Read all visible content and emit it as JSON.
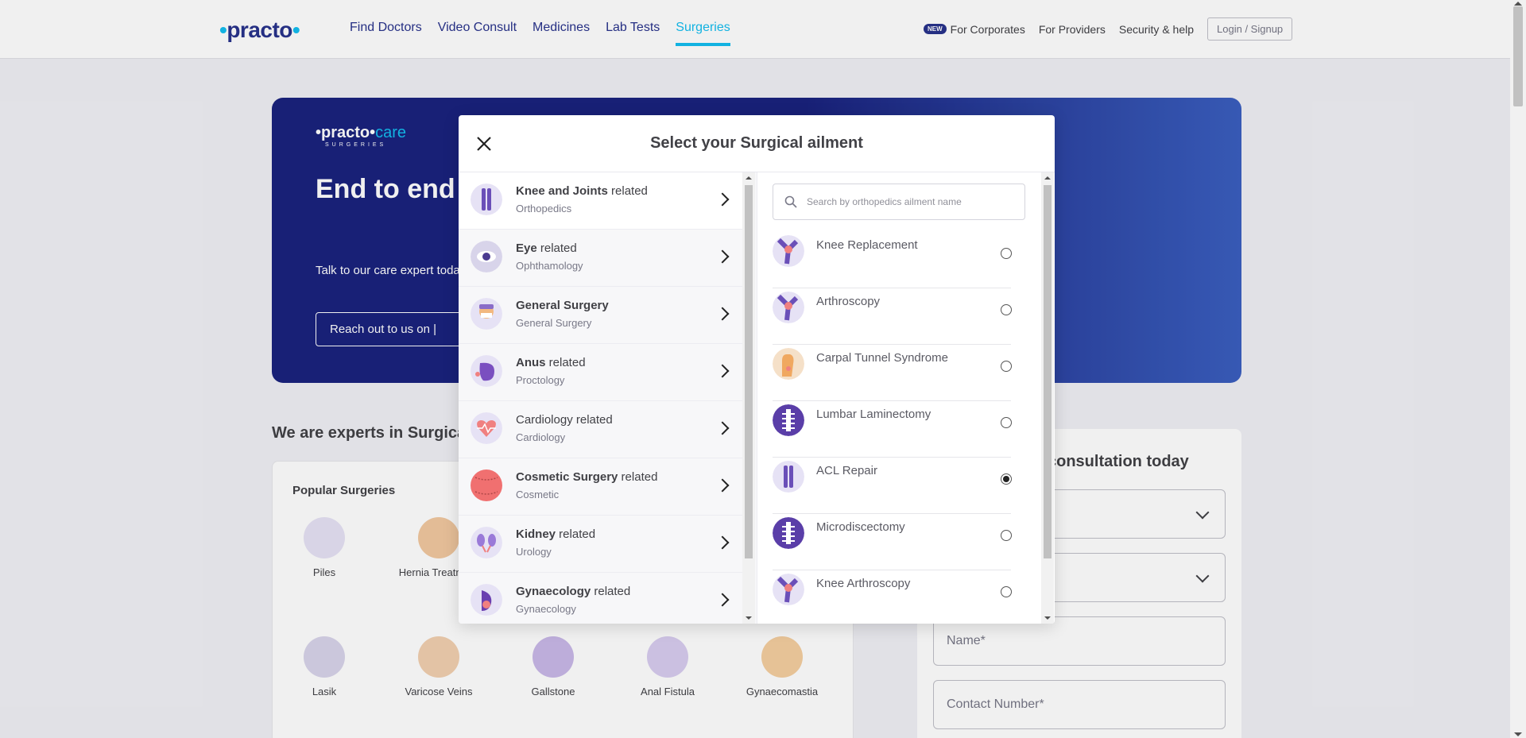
{
  "header": {
    "logo": "practo",
    "nav": [
      "Find Doctors",
      "Video Consult",
      "Medicines",
      "Lab Tests",
      "Surgeries"
    ],
    "active_nav": "Surgeries",
    "new_badge": "NEW",
    "right_links": [
      "For Corporates",
      "For Providers",
      "Security & help"
    ],
    "login_label": "Login / Signup"
  },
  "banner": {
    "logo_main": "•practo•",
    "logo_care": "care",
    "logo_sub": "SURGERIES",
    "title": "End to end care at our Practo",
    "subtitle": "Talk to our care expert today. All insurance accepted & No",
    "button_label": "Reach out to us on   |"
  },
  "experts_heading": "We are experts in Surgical",
  "popular": {
    "title": "Popular Surgeries",
    "items": [
      {
        "label": "Piles",
        "color": "#6a5acd"
      },
      {
        "label": "Hernia Treatment",
        "color": "#e8a66a"
      },
      {
        "label": "Lasik",
        "color": "#5a4aa0"
      },
      {
        "label": "Varicose Veins",
        "color": "#e8a66a"
      },
      {
        "label": "Gallstone",
        "color": "#8a6cc8"
      },
      {
        "label": "Anal Fistula",
        "color": "#5a3ea8"
      },
      {
        "label": "Gynaecomastia",
        "color": "#f0a860"
      }
    ]
  },
  "consult": {
    "title": "consultation today",
    "name_placeholder": "Name*",
    "contact_placeholder": "Contact Number*"
  },
  "modal": {
    "title": "Select your Surgical ailment",
    "categories": [
      {
        "bold": "Knee and Joints",
        "rest": " related",
        "sub": "Orthopedics",
        "color": "#6a4fb8"
      },
      {
        "bold": "Eye",
        "rest": " related",
        "sub": "Ophthamology",
        "color": "#4a3a90"
      },
      {
        "bold": "General Surgery",
        "rest": "",
        "sub": "General Surgery",
        "color": "#f2b880"
      },
      {
        "bold": "Anus",
        "rest": " related",
        "sub": "Proctology",
        "color": "#7a4fc0"
      },
      {
        "bold": "",
        "rest": "Cardiology related",
        "sub": "Cardiology",
        "color": "#f08080"
      },
      {
        "bold": "Cosmetic Surgery",
        "rest": " related",
        "sub": "Cosmetic",
        "color": "#f07070"
      },
      {
        "bold": "Kidney",
        "rest": " related",
        "sub": "Urology",
        "color": "#9a7ad8"
      },
      {
        "bold": "Gynaecology",
        "rest": " related",
        "sub": "Gynaecology",
        "color": "#6a3fb0"
      }
    ],
    "search_placeholder": "Search by orthopedics ailment name",
    "ailments": [
      {
        "name": "Knee Replacement",
        "selected": false,
        "color": "#6a4fb8"
      },
      {
        "name": "Arthroscopy",
        "selected": false,
        "color": "#6a4fb8"
      },
      {
        "name": "Carpal Tunnel Syndrome",
        "selected": false,
        "color": "#f0a860"
      },
      {
        "name": "Lumbar Laminectomy",
        "selected": false,
        "color": "#5a3ea8"
      },
      {
        "name": "ACL Repair",
        "selected": true,
        "color": "#6a4fb8"
      },
      {
        "name": "Microdiscectomy",
        "selected": false,
        "color": "#5a3ea8"
      },
      {
        "name": "Knee Arthroscopy",
        "selected": false,
        "color": "#6a4fb8"
      }
    ]
  }
}
